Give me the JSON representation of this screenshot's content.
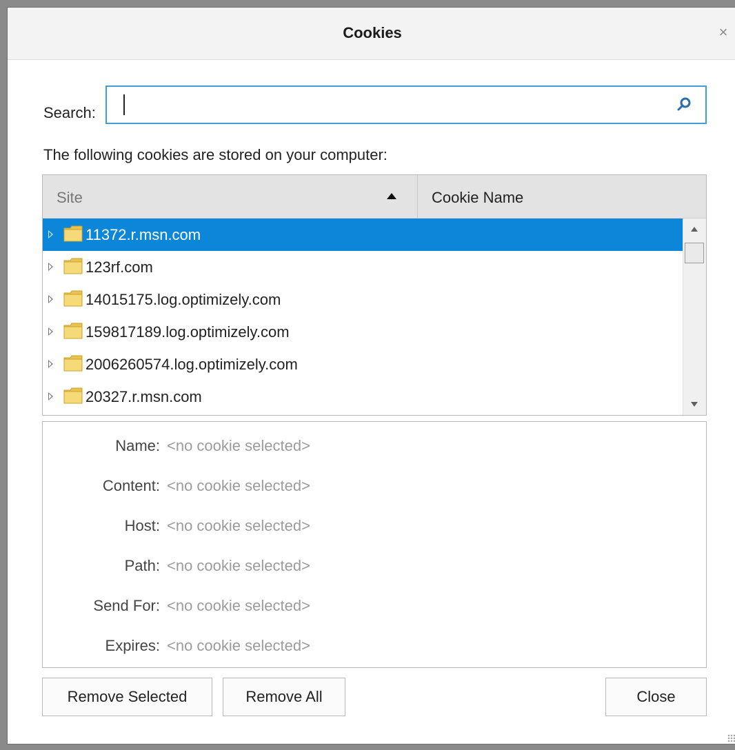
{
  "dialog": {
    "title": "Cookies",
    "close_glyph": "×"
  },
  "search": {
    "label": "Search:",
    "value": "",
    "icon": "search-icon"
  },
  "info_text": "The following cookies are stored on your computer:",
  "tree": {
    "columns": {
      "site": "Site",
      "cookie_name": "Cookie Name"
    },
    "sort": "ascending",
    "rows": [
      {
        "site": "11372.r.msn.com",
        "selected": true
      },
      {
        "site": "123rf.com",
        "selected": false
      },
      {
        "site": "14015175.log.optimizely.com",
        "selected": false
      },
      {
        "site": "159817189.log.optimizely.com",
        "selected": false
      },
      {
        "site": "2006260574.log.optimizely.com",
        "selected": false
      },
      {
        "site": "20327.r.msn.com",
        "selected": false
      }
    ]
  },
  "details": {
    "fields": [
      {
        "label": "Name:",
        "value": "<no cookie selected>"
      },
      {
        "label": "Content:",
        "value": "<no cookie selected>"
      },
      {
        "label": "Host:",
        "value": "<no cookie selected>"
      },
      {
        "label": "Path:",
        "value": "<no cookie selected>"
      },
      {
        "label": "Send For:",
        "value": "<no cookie selected>"
      },
      {
        "label": "Expires:",
        "value": "<no cookie selected>"
      }
    ]
  },
  "buttons": {
    "remove_selected": "Remove Selected",
    "remove_all": "Remove All",
    "close": "Close"
  },
  "colors": {
    "selection": "#0c86d8",
    "search_border": "#3c9fd6",
    "folder": "#f2cd5c"
  }
}
